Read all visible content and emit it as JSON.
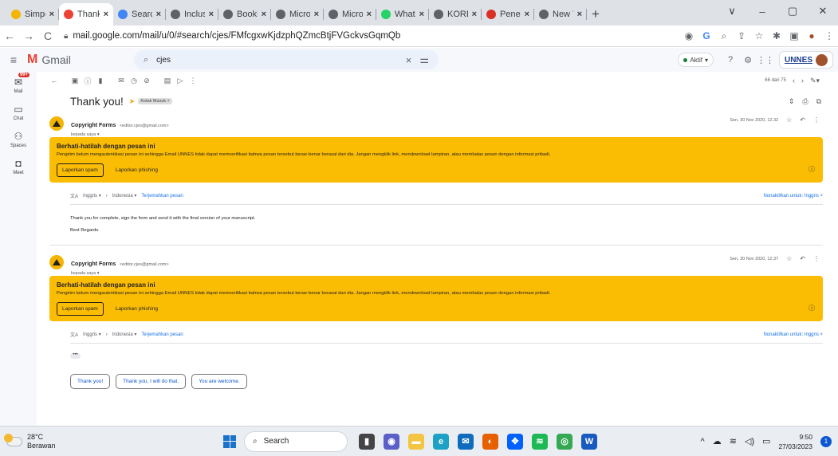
{
  "browser": {
    "tabs": [
      {
        "title": "Simpe",
        "favicon_color": "#f4b400",
        "favicon": "star-icon"
      },
      {
        "title": "Thank",
        "favicon_color": "#ea4335",
        "favicon": "gmail-icon",
        "active": true
      },
      {
        "title": "Search",
        "favicon_color": "#4285f4",
        "favicon": "grid-icon"
      },
      {
        "title": "Inclusi",
        "favicon_color": "#5f6368",
        "favicon": "globe-icon"
      },
      {
        "title": "Bookle",
        "favicon_color": "#5f6368",
        "favicon": "globe-icon"
      },
      {
        "title": "Micros",
        "favicon_color": "#5f6368",
        "favicon": "globe-icon"
      },
      {
        "title": "Micros",
        "favicon_color": "#5f6368",
        "favicon": "globe-icon"
      },
      {
        "title": "Whats",
        "favicon_color": "#25d366",
        "favicon": "whatsapp-icon"
      },
      {
        "title": "KORES",
        "favicon_color": "#5f6368",
        "favicon": "globe-icon"
      },
      {
        "title": "Penelit",
        "favicon_color": "#d93025",
        "favicon": "research-icon"
      },
      {
        "title": "New T",
        "favicon_color": "#5f6368",
        "favicon": "globe-icon"
      }
    ],
    "close_glyph": "×",
    "new_tab": "+",
    "window_controls": [
      "∨",
      "–",
      "▢",
      "✕"
    ],
    "url": "mail.google.com/mail/u/0/#search/cjes/FMfcgxwKjdzphQZmcBtjFVGckvsGqmQb"
  },
  "gmail": {
    "logo": "Gmail",
    "search_value": "cjes",
    "status": "Aktif",
    "account_brand": "UNNES",
    "rail": [
      {
        "label": "Mail",
        "icon": "mail-icon",
        "badge": "99+"
      },
      {
        "label": "Chat",
        "icon": "chat-icon"
      },
      {
        "label": "Spaces",
        "icon": "spaces-icon"
      },
      {
        "label": "Meet",
        "icon": "meet-icon"
      }
    ],
    "pager": "66 dari 75",
    "subject": "Thank you!",
    "label": "Kotak Masuk ×"
  },
  "messages": [
    {
      "sender_name": "Copyright Forms",
      "sender_email": "<editor.cjes@gmail.com>",
      "to": "kepada saya ▾",
      "date": "Sen, 30 Nov 2020, 12.32",
      "warning_title": "Berhati-hatilah dengan pesan ini",
      "warning_body": "Pengirim belum mengautentikasi pesan ini sehingga Email UNNES tidak dapat memverifikasi bahwa pesan tersebut benar-benar berasal dari dia. Jangan mengklik link, mendownload lampiran, atau membalas pesan dengan informasi pribadi.",
      "report_spam": "Laporkan spam",
      "report_phishing": "Laporkan phishing",
      "translate_from": "Inggris ▾",
      "translate_to": "Indonesia ▾",
      "translate_link": "Terjemahkan pesan",
      "translate_off": "Nonaktifkan untuk: Inggris",
      "body_lines": [
        "Thank you for complete, sign the form and send it with the final version of your manuscript.",
        "Best Regards."
      ]
    },
    {
      "sender_name": "Copyright Forms",
      "sender_email": "<editor.cjes@gmail.com>",
      "to": "kepada saya ▾",
      "date": "Sen, 30 Nov 2020, 12.37",
      "warning_title": "Berhati-hatilah dengan pesan ini",
      "warning_body": "Pengirim belum mengautentikasi pesan ini sehingga Email UNNES tidak dapat memverifikasi bahwa pesan tersebut benar-benar berasal dari dia. Jangan mengklik link, mendownload lampiran, atau membalas pesan dengan informasi pribadi.",
      "report_spam": "Laporkan spam",
      "report_phishing": "Laporkan phishing",
      "translate_from": "Inggris ▾",
      "translate_to": "Indonesia ▾",
      "translate_link": "Terjemahkan pesan",
      "translate_off": "Nonaktifkan untuk: Inggris",
      "quoted_dots": "•••"
    }
  ],
  "smart_replies": [
    "Thank you!",
    "Thank you, I will do that.",
    "You are welcome."
  ],
  "taskbar": {
    "temperature": "28°C",
    "weather": "Berawan",
    "search": "Search",
    "time": "9:50",
    "date": "27/03/2023",
    "notif_count": "1"
  }
}
